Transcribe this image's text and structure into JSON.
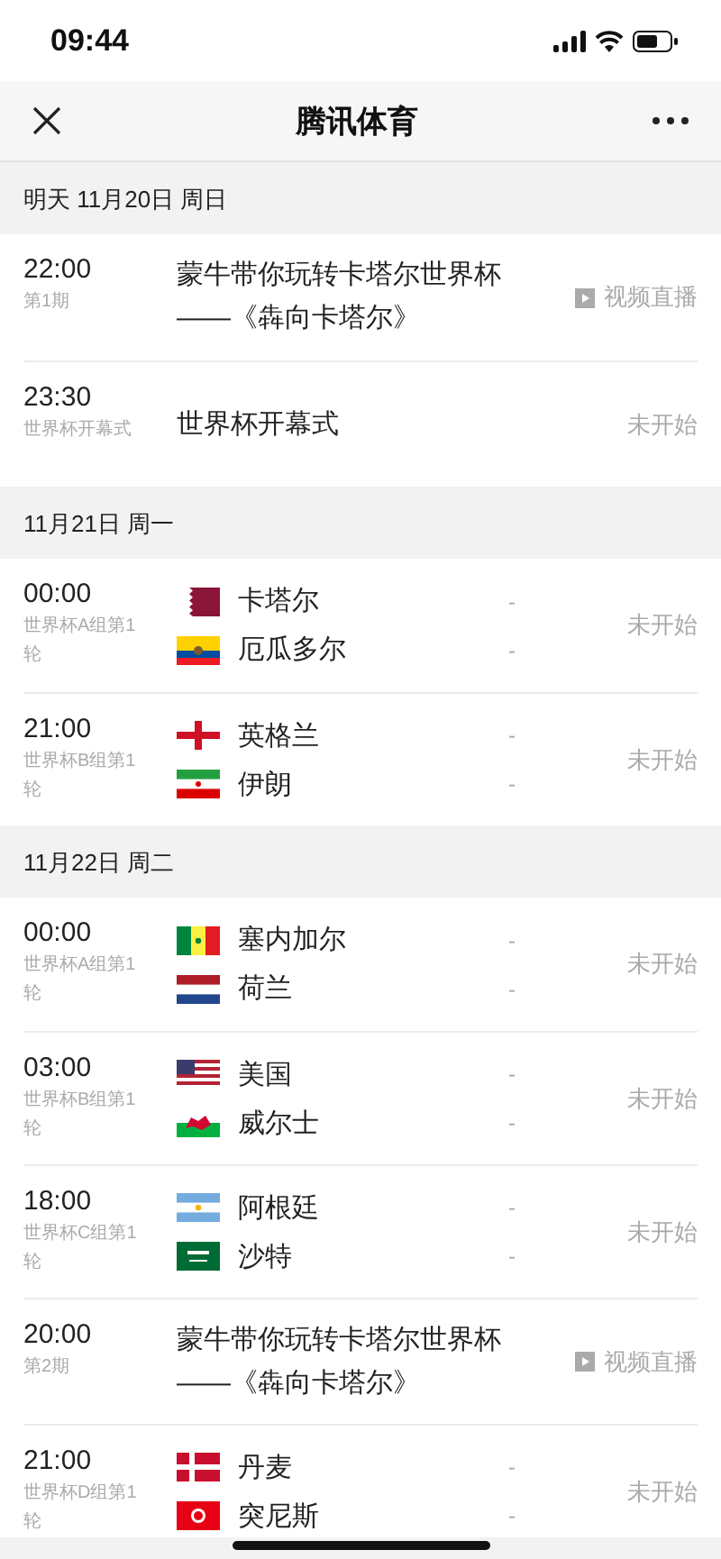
{
  "status_bar": {
    "time": "09:44"
  },
  "nav": {
    "title": "腾讯体育"
  },
  "sections": [
    {
      "date": "明天 11月20日 周日",
      "items": [
        {
          "kind": "show",
          "time": "22:00",
          "subtitle": "第1期",
          "title": "蒙牛带你玩转卡塔尔世界杯——《犇向卡塔尔》",
          "status": "视频直播"
        },
        {
          "kind": "event",
          "time": "23:30",
          "subtitle": "世界杯开幕式",
          "title": "世界杯开幕式",
          "status": "未开始"
        }
      ]
    },
    {
      "date": "11月21日 周一",
      "items": [
        {
          "kind": "match",
          "time": "00:00",
          "subtitle": "世界杯A组第1轮",
          "teams": [
            {
              "name": "卡塔尔",
              "kind": "qa",
              "score": "-"
            },
            {
              "name": "厄瓜多尔",
              "kind": "ec",
              "score": "-"
            }
          ],
          "status": "未开始"
        },
        {
          "kind": "match",
          "time": "21:00",
          "subtitle": "世界杯B组第1轮",
          "teams": [
            {
              "name": "英格兰",
              "kind": "en",
              "score": "-"
            },
            {
              "name": "伊朗",
              "kind": "ir",
              "score": "-"
            }
          ],
          "status": "未开始"
        }
      ]
    },
    {
      "date": "11月22日 周二",
      "items": [
        {
          "kind": "match",
          "time": "00:00",
          "subtitle": "世界杯A组第1轮",
          "teams": [
            {
              "name": "塞内加尔",
              "kind": "sn",
              "score": "-"
            },
            {
              "name": "荷兰",
              "kind": "nl",
              "score": "-"
            }
          ],
          "status": "未开始"
        },
        {
          "kind": "match",
          "time": "03:00",
          "subtitle": "世界杯B组第1轮",
          "teams": [
            {
              "name": "美国",
              "kind": "us",
              "score": "-"
            },
            {
              "name": "威尔士",
              "kind": "wl",
              "score": "-"
            }
          ],
          "status": "未开始"
        },
        {
          "kind": "match",
          "time": "18:00",
          "subtitle": "世界杯C组第1轮",
          "teams": [
            {
              "name": "阿根廷",
              "kind": "ar",
              "score": "-"
            },
            {
              "name": "沙特",
              "kind": "sa",
              "score": "-"
            }
          ],
          "status": "未开始"
        },
        {
          "kind": "show",
          "time": "20:00",
          "subtitle": "第2期",
          "title": "蒙牛带你玩转卡塔尔世界杯——《犇向卡塔尔》",
          "status": "视频直播"
        },
        {
          "kind": "match",
          "time": "21:00",
          "subtitle": "世界杯D组第1轮",
          "teams": [
            {
              "name": "丹麦",
              "kind": "dk",
              "score": "-"
            },
            {
              "name": "突尼斯",
              "kind": "tn",
              "score": "-"
            }
          ],
          "status": "未开始"
        }
      ]
    }
  ]
}
